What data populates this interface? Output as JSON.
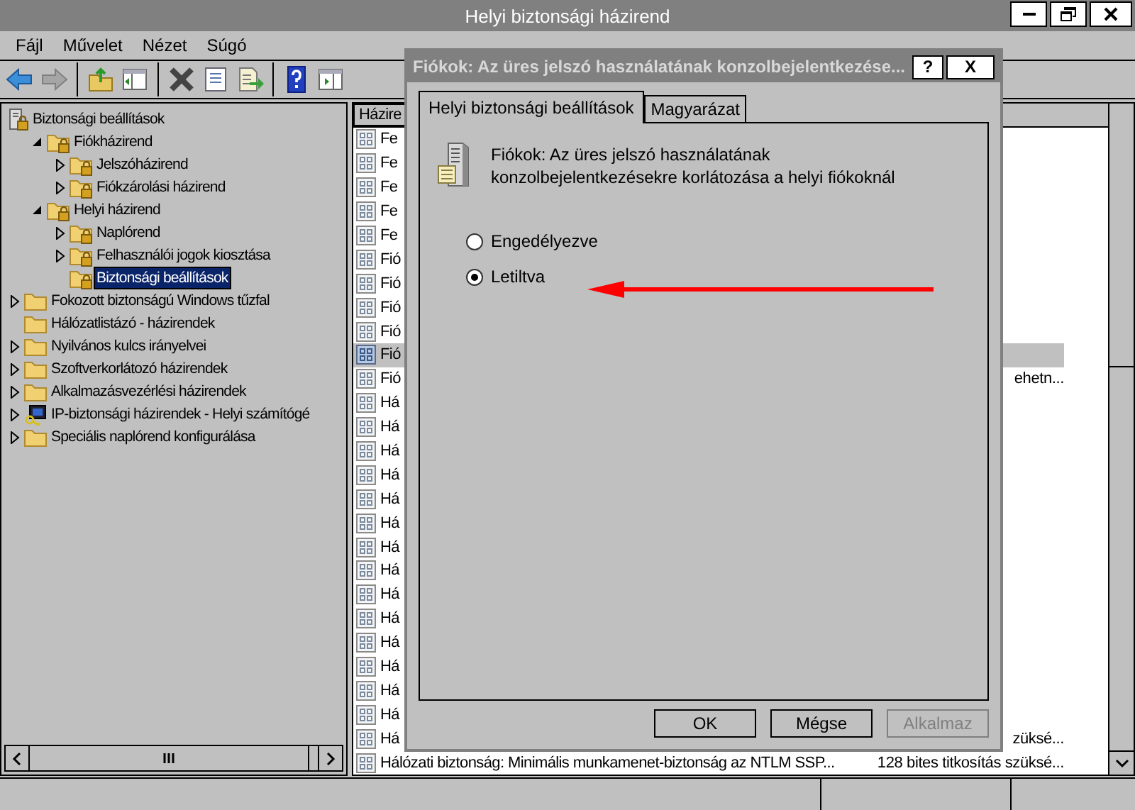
{
  "window": {
    "title": "Helyi biztonsági házirend"
  },
  "menu": [
    "Fájl",
    "Művelet",
    "Nézet",
    "Súgó"
  ],
  "toolbar": [
    {
      "kind": "back",
      "disabled": false
    },
    {
      "kind": "forward",
      "disabled": true
    },
    {
      "kind": "sep"
    },
    {
      "kind": "up"
    },
    {
      "kind": "tree"
    },
    {
      "kind": "sep"
    },
    {
      "kind": "delete"
    },
    {
      "kind": "properties"
    },
    {
      "kind": "export"
    },
    {
      "kind": "sep"
    },
    {
      "kind": "help"
    },
    {
      "kind": "pane"
    }
  ],
  "tree": [
    {
      "label": "Biztonsági beállítások",
      "kind": "server",
      "expandable": false,
      "selected": false,
      "children": [
        {
          "label": "Fiókházirend",
          "kind": "lockfolder",
          "expandable": true,
          "expanded": true,
          "selected": false,
          "children": [
            {
              "label": "Jelszóházirend",
              "kind": "lockfolder",
              "expandable": true,
              "expanded": false,
              "selected": false
            },
            {
              "label": "Fiókzárolási házirend",
              "kind": "lockfolder",
              "expandable": true,
              "expanded": false,
              "selected": false
            }
          ]
        },
        {
          "label": "Helyi házirend",
          "kind": "lockfolder",
          "expandable": true,
          "expanded": true,
          "selected": false,
          "children": [
            {
              "label": "Naplórend",
              "kind": "lockfolder",
              "expandable": true,
              "expanded": false,
              "selected": false
            },
            {
              "label": "Felhasználói jogok kiosztása",
              "kind": "lockfolder",
              "expandable": true,
              "expanded": false,
              "selected": false
            },
            {
              "label": "Biztonsági beállítások",
              "kind": "lockfolder",
              "expandable": false,
              "selected": true
            }
          ]
        }
      ]
    },
    {
      "label": "Fokozott biztonságú Windows tűzfal",
      "kind": "folder",
      "expandable": true,
      "expanded": false,
      "selected": false
    },
    {
      "label": "Hálózatlistázó - házirendek",
      "kind": "folder",
      "expandable": false,
      "selected": false
    },
    {
      "label": "Nyilvános kulcs irányelvei",
      "kind": "folder",
      "expandable": true,
      "expanded": false,
      "selected": false
    },
    {
      "label": "Szoftverkorlátozó házirendek",
      "kind": "folder",
      "expandable": true,
      "expanded": false,
      "selected": false
    },
    {
      "label": "Alkalmazásvezérlési házirendek",
      "kind": "folder",
      "expandable": true,
      "expanded": false,
      "selected": false
    },
    {
      "label": "IP-biztonsági házirendek - Helyi számítógé",
      "kind": "ip",
      "expandable": true,
      "expanded": false,
      "selected": false
    },
    {
      "label": "Speciális naplórend konfigurálása",
      "kind": "folder",
      "expandable": true,
      "expanded": false,
      "selected": false
    }
  ],
  "list": {
    "columns": [
      "Házire"
    ],
    "rows": [
      {
        "column_1": "Fe",
        "selected": false
      },
      {
        "column_1": "Fe",
        "selected": false
      },
      {
        "column_1": "Fe",
        "selected": false
      },
      {
        "column_1": "Fe",
        "selected": false
      },
      {
        "column_1": "Fe",
        "selected": false
      },
      {
        "column_1": "Fió",
        "selected": false
      },
      {
        "column_1": "Fió",
        "selected": false
      },
      {
        "column_1": "Fió",
        "selected": false
      },
      {
        "column_1": "Fió",
        "selected": false
      },
      {
        "column_1": "Fió",
        "selected": true
      },
      {
        "column_1": "Fió",
        "column_2": "ehetn...",
        "selected": false
      },
      {
        "column_1": "Há",
        "selected": false
      },
      {
        "column_1": "Há",
        "selected": false
      },
      {
        "column_1": "Há",
        "selected": false
      },
      {
        "column_1": "Há",
        "selected": false
      },
      {
        "column_1": "Há",
        "selected": false
      },
      {
        "column_1": "Há",
        "selected": false
      },
      {
        "column_1": "Há",
        "selected": false
      },
      {
        "column_1": "Há",
        "selected": false
      },
      {
        "column_1": "Há",
        "selected": false
      },
      {
        "column_1": "Há",
        "selected": false
      },
      {
        "column_1": "Há",
        "selected": false
      },
      {
        "column_1": "Há",
        "selected": false
      },
      {
        "column_1": "Há",
        "selected": false
      },
      {
        "column_1": "Há",
        "selected": false
      },
      {
        "column_1": "Há",
        "column_2": "züksé...",
        "selected": false
      },
      {
        "column_1": "Hálózati biztonság: Minimális munkamenet-biztonság az NTLM SSP...",
        "column_2": "128 bites titkosítás szüksé...",
        "selected": false
      }
    ]
  },
  "dialog": {
    "title": "Fiókok: Az üres jelszó használatának konzolbejelentkezése...",
    "title_buttons": [
      "?",
      "X"
    ],
    "tabs": [
      {
        "label": "Helyi biztonsági beállítások",
        "selected": true
      },
      {
        "label": "Magyarázat",
        "selected": false
      }
    ],
    "description": "Fiókok: Az üres jelszó használatának konzolbejelentkezésekre korlátozása a helyi fiókoknál",
    "options": [
      {
        "label": "Engedélyezve",
        "selected": false
      },
      {
        "label": "Letiltva",
        "selected": true
      }
    ],
    "buttons": [
      {
        "label": "OK",
        "disabled": false
      },
      {
        "label": "Mégse",
        "disabled": false
      },
      {
        "label": "Alkalmaz",
        "disabled": true
      }
    ]
  }
}
